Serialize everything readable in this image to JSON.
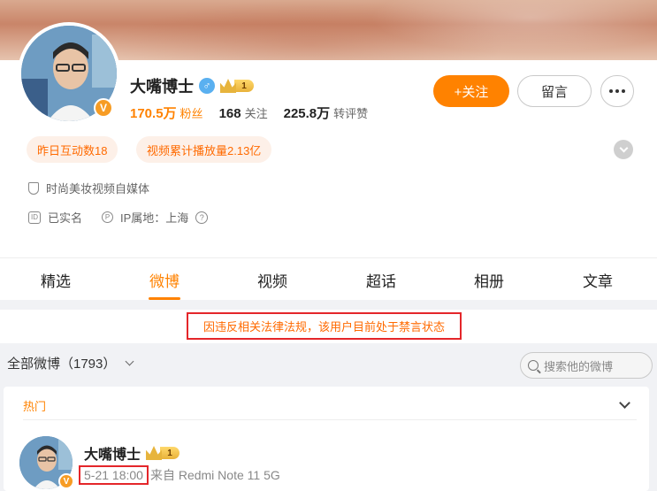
{
  "profile": {
    "name": "大嘴博士",
    "gender_icon": "male-icon",
    "level_badge": "1",
    "verify_badge": "V",
    "stats": {
      "fans_value": "170.5万",
      "fans_label": "粉丝",
      "follow_value": "168",
      "follow_label": "关注",
      "reposts_value": "225.8万",
      "reposts_label": "转评赞"
    },
    "buttons": {
      "follow": "+关注",
      "message": "留言"
    },
    "tags": [
      "昨日互动数18",
      "视频累计播放量2.13亿"
    ],
    "category": "时尚美妆视频自媒体",
    "realname": "已实名",
    "ip_location": "IP属地：上海"
  },
  "tabs": [
    "精选",
    "微博",
    "视频",
    "超话",
    "相册",
    "文章"
  ],
  "active_tab": "微博",
  "notice": "因违反相关法律法规，该用户目前处于禁言状态",
  "filter": {
    "label": "全部微博（1793）",
    "search_placeholder": "搜索他的微博"
  },
  "feed": {
    "section_label": "热门",
    "post": {
      "author": "大嘴博士",
      "time": "5-21 18:00",
      "source": "来自 Redmi Note 11 5G"
    }
  },
  "colors": {
    "accent": "#ff8200",
    "alert_border": "#e4262a",
    "tag_bg": "#fdf0e8"
  }
}
